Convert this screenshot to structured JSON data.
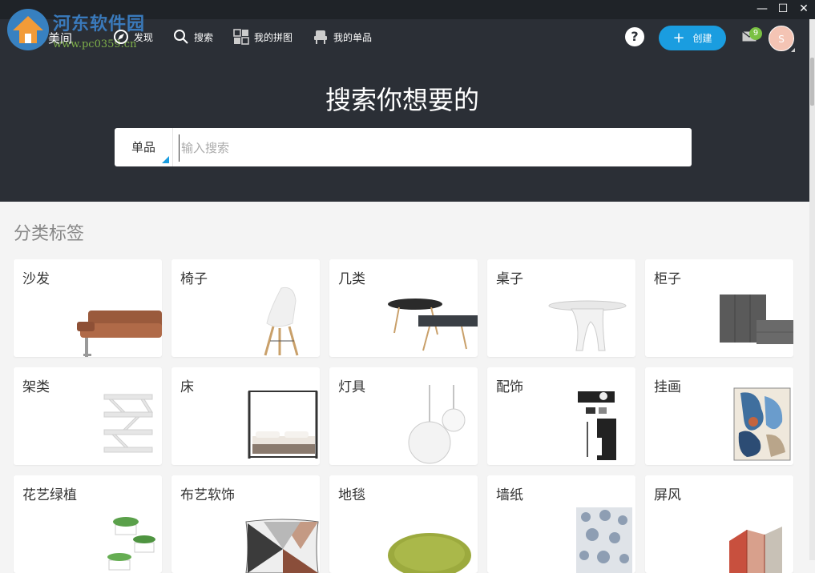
{
  "app": {
    "name": "美间"
  },
  "watermark": {
    "text": "河东软件园",
    "url": "www.pc0359.cn"
  },
  "window": {
    "minimize": "—",
    "maximize": "☐",
    "close": "✕"
  },
  "nav": {
    "items": [
      {
        "label": "发现",
        "icon": "compass-icon"
      },
      {
        "label": "搜索",
        "icon": "search-icon"
      },
      {
        "label": "我的拼图",
        "icon": "collage-icon"
      },
      {
        "label": "我的单品",
        "icon": "chair-icon"
      }
    ],
    "help": "?",
    "create_label": "创建",
    "create_plus": "+",
    "mail_count": "9",
    "avatar_letter": "S"
  },
  "hero": {
    "title": "搜索你想要的"
  },
  "search": {
    "type_label": "单品",
    "placeholder": "输入搜索",
    "value": ""
  },
  "categories_title": "分类标签",
  "categories": [
    {
      "label": "沙发",
      "icon": "sofa-icon"
    },
    {
      "label": "椅子",
      "icon": "chair-icon"
    },
    {
      "label": "几类",
      "icon": "coffee-table-icon"
    },
    {
      "label": "桌子",
      "icon": "table-icon"
    },
    {
      "label": "柜子",
      "icon": "cabinet-icon"
    },
    {
      "label": "架类",
      "icon": "shelf-icon"
    },
    {
      "label": "床",
      "icon": "bed-icon"
    },
    {
      "label": "灯具",
      "icon": "lamp-icon"
    },
    {
      "label": "配饰",
      "icon": "accessory-icon"
    },
    {
      "label": "挂画",
      "icon": "painting-icon"
    },
    {
      "label": "花艺绿植",
      "icon": "plant-icon"
    },
    {
      "label": "布艺软饰",
      "icon": "cushion-icon"
    },
    {
      "label": "地毯",
      "icon": "rug-icon"
    },
    {
      "label": "墙纸",
      "icon": "wallpaper-icon"
    },
    {
      "label": "屏风",
      "icon": "screen-icon"
    }
  ],
  "colors": {
    "accent": "#1a9de0",
    "header_bg": "#2b2f36",
    "badge": "#7ac143",
    "avatar": "#f4c4b4"
  }
}
